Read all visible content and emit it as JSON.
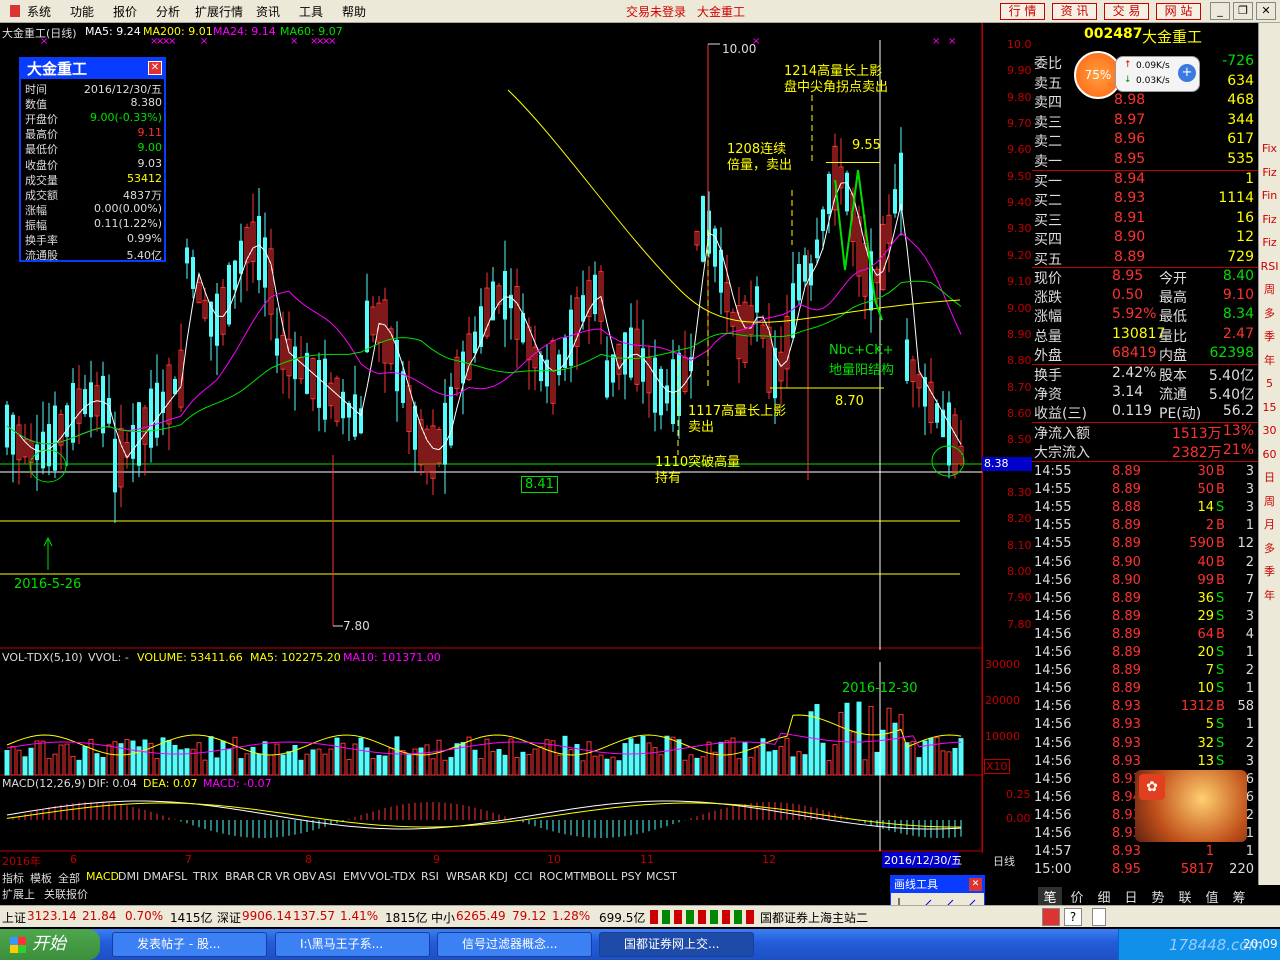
{
  "menu": {
    "items": [
      "系统",
      "功能",
      "报价",
      "分析",
      "扩展行情",
      "资讯",
      "工具",
      "帮助"
    ],
    "status": "交易未登录",
    "stock": "大金重工",
    "tabs": [
      "行 情",
      "资 讯",
      "交 易",
      "网 站"
    ]
  },
  "chart_header": {
    "name": "大金重工(日线)",
    "ma5": "MA5: 9.24",
    "ma200": "MA200: 9.01",
    "ma24": "MA24: 9.14",
    "ma60": "MA60: 9.07"
  },
  "colors": {
    "up": "#ff3232",
    "down": "#54fcfc",
    "ma5": "#ffffff",
    "ma200": "#ffff00",
    "ma24": "#ff00ff",
    "ma60": "#00e000",
    "accent": "#0a3cff"
  },
  "infobox": {
    "title": "大金重工",
    "rows": [
      {
        "k": "时间",
        "v": "2016/12/30/五",
        "c": "#ddd"
      },
      {
        "k": "数值",
        "v": "8.380",
        "c": "#ddd"
      },
      {
        "k": "开盘价",
        "v": "9.00(-0.33%)",
        "c": "#00e000"
      },
      {
        "k": "最高价",
        "v": "9.11",
        "c": "#ff3232"
      },
      {
        "k": "最低价",
        "v": "9.00",
        "c": "#00e000"
      },
      {
        "k": "收盘价",
        "v": "9.03",
        "c": "#ddd"
      },
      {
        "k": "成交量",
        "v": "53412",
        "c": "#ffff00"
      },
      {
        "k": "成交额",
        "v": "4837万",
        "c": "#ddd"
      },
      {
        "k": "涨幅",
        "v": "0.00(0.00%)",
        "c": "#ddd"
      },
      {
        "k": "振幅",
        "v": "0.11(1.22%)",
        "c": "#ddd"
      },
      {
        "k": "换手率",
        "v": "0.99%",
        "c": "#ddd"
      },
      {
        "k": "流通股",
        "v": "5.40亿",
        "c": "#ddd"
      }
    ]
  },
  "annotations": {
    "a1214": "1214高量长上影",
    "a1214b": "盘中尖角拐点卖出",
    "a1208": "1208连续",
    "a1208b": "倍量，卖出",
    "p955": "9.55",
    "nbc": "Nbc+CK+",
    "nbc2": "地量阳结构",
    "p870": "8.70",
    "a1117": "1117高量长上影",
    "a1117b": "卖出",
    "a1110": "1110突破高量",
    "a1110b": "持有",
    "p841": "8.41",
    "d0526": "2016-5-26",
    "p780": "7.80",
    "p1000": "10.00",
    "d1230": "2016-12-30"
  },
  "price_axis": [
    "10.00",
    "9.90",
    "9.80",
    "9.70",
    "9.60",
    "9.50",
    "9.40",
    "9.30",
    "9.20",
    "9.10",
    "9.00",
    "8.90",
    "8.80",
    "8.70",
    "8.60",
    "8.50",
    "8.40",
    "8.30",
    "8.20",
    "8.10",
    "8.00",
    "7.90",
    "7.80"
  ],
  "cursor_price": "8.38",
  "vol_header": {
    "name": "VOL-TDX(5,10)",
    "vvol": "VVOL: -",
    "volume": "VOLUME: 53411.66",
    "ma5": "MA5: 102275.20",
    "ma10": "MA10: 101371.00"
  },
  "vol_axis": [
    "30000",
    "20000",
    "10000"
  ],
  "vol_unit": "X10",
  "macd_header": {
    "name": "MACD(12,26,9)",
    "dif": "DIF: 0.04",
    "dea": "DEA: 0.07",
    "macd": "MACD: -0.07"
  },
  "macd_axis": [
    "0.25",
    "0.00"
  ],
  "date_axis": [
    "2016年",
    "6",
    "7",
    "8",
    "9",
    "10",
    "11",
    "12"
  ],
  "date_cursor": "2016/12/30/五",
  "indicator_tabs": [
    "指标",
    "模板",
    "全部",
    "MACD",
    "DMI",
    "DMA",
    "FSL",
    "TRIX",
    "BRAR",
    "CR",
    "VR",
    "OBV",
    "ASI",
    "EMV",
    "VOL-TDX",
    "RSI",
    "WR",
    "SAR",
    "KDJ",
    "CCI",
    "ROC",
    "MTM",
    "BOLL",
    "PSY",
    "MCST"
  ],
  "ext_tabs": [
    "扩展上",
    "关联报价"
  ],
  "draw_tool": {
    "title": "画线工具"
  },
  "daily_label": "日线",
  "quote": {
    "code": "002487",
    "name": "大金重工",
    "webi_k": "委比",
    "webi_v": "-726",
    "gauge": "75%",
    "speed_up": "0.09K/s",
    "speed_down": "0.03K/s",
    "asks": [
      {
        "k": "卖五",
        "p": "",
        "v": "634"
      },
      {
        "k": "卖四",
        "p": "8.98",
        "v": "468"
      },
      {
        "k": "卖三",
        "p": "8.97",
        "v": "344"
      },
      {
        "k": "卖二",
        "p": "8.96",
        "v": "617"
      },
      {
        "k": "卖一",
        "p": "8.95",
        "v": "535"
      }
    ],
    "bids": [
      {
        "k": "买一",
        "p": "8.94",
        "v": "1"
      },
      {
        "k": "买二",
        "p": "8.93",
        "v": "1114"
      },
      {
        "k": "买三",
        "p": "8.91",
        "v": "16"
      },
      {
        "k": "买四",
        "p": "8.90",
        "v": "12"
      },
      {
        "k": "买五",
        "p": "8.89",
        "v": "729"
      }
    ],
    "stats": [
      {
        "k1": "现价",
        "v1": "8.95",
        "k2": "今开",
        "v2": "8.40",
        "c1": "#ff3232",
        "c2": "#00e000"
      },
      {
        "k1": "涨跌",
        "v1": "0.50",
        "k2": "最高",
        "v2": "9.10",
        "c1": "#ff3232",
        "c2": "#ff3232"
      },
      {
        "k1": "涨幅",
        "v1": "5.92%",
        "k2": "最低",
        "v2": "8.34",
        "c1": "#ff3232",
        "c2": "#00e000"
      },
      {
        "k1": "总量",
        "v1": "130817",
        "k2": "量比",
        "v2": "2.47",
        "c1": "#ffff00",
        "c2": "#ff3232"
      },
      {
        "k1": "外盘",
        "v1": "68419",
        "k2": "内盘",
        "v2": "62398",
        "c1": "#ff3232",
        "c2": "#00e000"
      }
    ],
    "stats2": [
      {
        "k1": "换手",
        "v1": "2.42%",
        "k2": "股本",
        "v2": "5.40亿"
      },
      {
        "k1": "净资",
        "v1": "3.14",
        "k2": "流通",
        "v2": "5.40亿"
      },
      {
        "k1": "收益(三)",
        "v1": "0.119",
        "k2": "PE(动)",
        "v2": "56.2"
      }
    ],
    "flows": [
      {
        "k": "净流入额",
        "v": "1513万",
        "p": "13%"
      },
      {
        "k": "大宗流入",
        "v": "2382万",
        "p": "21%"
      }
    ],
    "ticks": [
      {
        "t": "14:55",
        "p": "8.89",
        "v": "30",
        "s": "B",
        "n": "3"
      },
      {
        "t": "14:55",
        "p": "8.89",
        "v": "50",
        "s": "B",
        "n": "3"
      },
      {
        "t": "14:55",
        "p": "8.88",
        "v": "14",
        "s": "S",
        "n": "3"
      },
      {
        "t": "14:55",
        "p": "8.89",
        "v": "2",
        "s": "B",
        "n": "1"
      },
      {
        "t": "14:55",
        "p": "8.89",
        "v": "590",
        "s": "B",
        "n": "12"
      },
      {
        "t": "14:56",
        "p": "8.90",
        "v": "40",
        "s": "B",
        "n": "2"
      },
      {
        "t": "14:56",
        "p": "8.90",
        "v": "99",
        "s": "B",
        "n": "7"
      },
      {
        "t": "14:56",
        "p": "8.89",
        "v": "36",
        "s": "S",
        "n": "7"
      },
      {
        "t": "14:56",
        "p": "8.89",
        "v": "29",
        "s": "S",
        "n": "3"
      },
      {
        "t": "14:56",
        "p": "8.89",
        "v": "64",
        "s": "B",
        "n": "4"
      },
      {
        "t": "14:56",
        "p": "8.89",
        "v": "20",
        "s": "S",
        "n": "1"
      },
      {
        "t": "14:56",
        "p": "8.89",
        "v": "7",
        "s": "S",
        "n": "2"
      },
      {
        "t": "14:56",
        "p": "8.89",
        "v": "10",
        "s": "S",
        "n": "1"
      },
      {
        "t": "14:56",
        "p": "8.93",
        "v": "1312",
        "s": "B",
        "n": "58"
      },
      {
        "t": "14:56",
        "p": "8.93",
        "v": "5",
        "s": "S",
        "n": "1"
      },
      {
        "t": "14:56",
        "p": "8.93",
        "v": "32",
        "s": "S",
        "n": "2"
      },
      {
        "t": "14:56",
        "p": "8.93",
        "v": "13",
        "s": "S",
        "n": "3"
      },
      {
        "t": "14:56",
        "p": "8.93",
        "v": "",
        "s": "",
        "n": "6"
      },
      {
        "t": "14:56",
        "p": "8.94",
        "v": "",
        "s": "",
        "n": "6"
      },
      {
        "t": "14:56",
        "p": "8.93",
        "v": "",
        "s": "",
        "n": "2"
      },
      {
        "t": "14:56",
        "p": "8.93",
        "v": "1",
        "s": "",
        "n": "1"
      },
      {
        "t": "14:57",
        "p": "8.93",
        "v": "1",
        "s": "",
        "n": "1"
      },
      {
        "t": "15:00",
        "p": "8.95",
        "v": "5817",
        "s": "",
        "n": "220"
      }
    ],
    "bottom_tabs": [
      "笔",
      "价",
      "细",
      "日",
      "势",
      "联",
      "值",
      "筹"
    ]
  },
  "right_tools": [
    "Fix",
    "Fiz",
    "Fin",
    "Fiz",
    "Fiz",
    "RSI",
    "周",
    "多",
    "季",
    "年",
    "5",
    "15",
    "30",
    "60",
    "日",
    "周",
    "月",
    "多",
    "季",
    "年"
  ],
  "statusbar": {
    "sh_k": "上证",
    "sh_v": "3123.14",
    "sh_c": "21.84",
    "sh_p": "0.70%",
    "sh_a": "1415亿",
    "sz_k": "深证",
    "sz_v": "9906.14",
    "sz_c": "137.57",
    "sz_p": "1.41%",
    "sz_a": "1815亿",
    "zx_k": "中小",
    "zx_v": "6265.49",
    "zx_c": "79.12",
    "zx_p": "1.28%",
    "zx_a": "699.5亿",
    "broker": "国都证券上海主站二"
  },
  "taskbar": {
    "start": "开始",
    "tasks": [
      "发表帖子 - 股...",
      "I:\\黑马王子系...",
      "信号过滤器概念...",
      "国都证券网上交..."
    ],
    "clock": "20:09",
    "watermark": "178448.com"
  }
}
